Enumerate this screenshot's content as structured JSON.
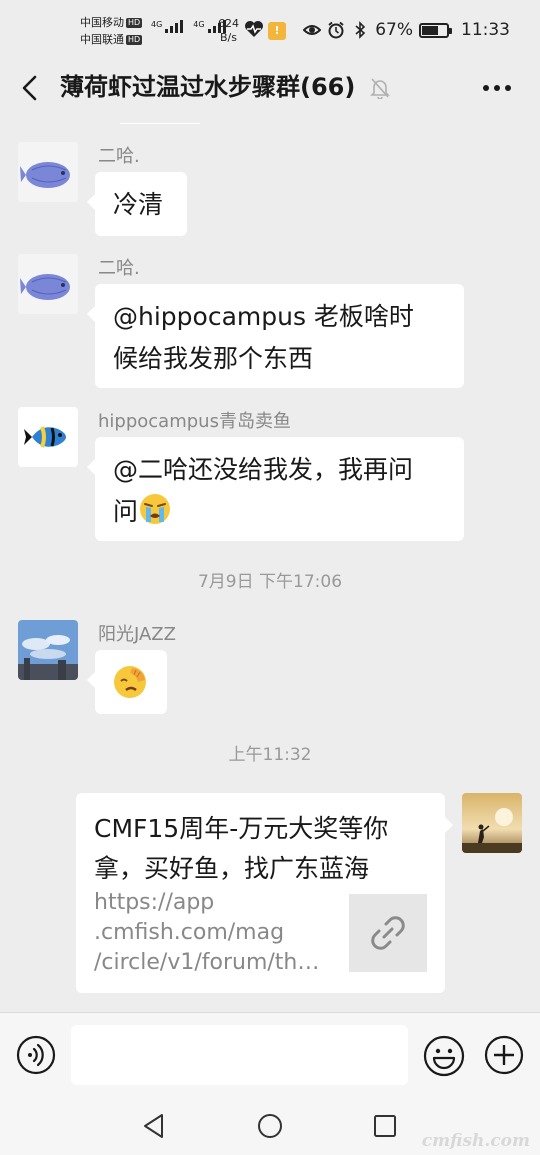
{
  "status_bar": {
    "carrier1": "中国移动",
    "carrier2": "中国联通",
    "hd_badge": "HD",
    "net_type": "4G",
    "speed_value": "624",
    "speed_unit": "B/s",
    "battery": "67%",
    "battery_level": 0.67,
    "time": "11:33",
    "icons": [
      "heartbeat-icon",
      "notice-icon",
      "eye-icon",
      "alarm-icon",
      "bluetooth-icon",
      "battery-icon"
    ]
  },
  "header": {
    "title": "薄荷虾过温过水步骤群(66)",
    "back_icon": "back-arrow-icon",
    "mute_icon": "bell-muted-icon",
    "more_icon": "more-dots-icon"
  },
  "messages": [
    {
      "sender": "二哈.",
      "text": "冷清"
    },
    {
      "sender": "二哈.",
      "line1": "@hippocampus 老板啥时",
      "line2": "候给我发那个东西"
    },
    {
      "sender": "hippocampus青岛卖鱼",
      "line1": "@二哈还没给我发，我再问",
      "line2": "问",
      "emoji": "crying-face-emoji"
    },
    {
      "sender": "阳光JAZZ",
      "emoji": "facepalm-emoji"
    }
  ],
  "timestamps": [
    "7月9日 下午17:06",
    "上午11:32"
  ],
  "link_card": {
    "title": "CMF15周年-万元大奖等你拿，买好鱼，找广东蓝海",
    "url": "https://app\n.cmfish.com/mag\n/circle/v1/forum/th…",
    "icon": "link-icon"
  },
  "input_bar": {
    "voice_icon": "voice-icon",
    "emoji_icon": "emoji-icon",
    "plus_icon": "plus-icon"
  },
  "nav": [
    "nav-back-icon",
    "nav-home-icon",
    "nav-recent-icon"
  ],
  "watermark": "cmfish.com",
  "colors": {
    "background": "#ededed",
    "bubble": "#ffffff",
    "text": "#191919",
    "muted_text": "#888888"
  }
}
